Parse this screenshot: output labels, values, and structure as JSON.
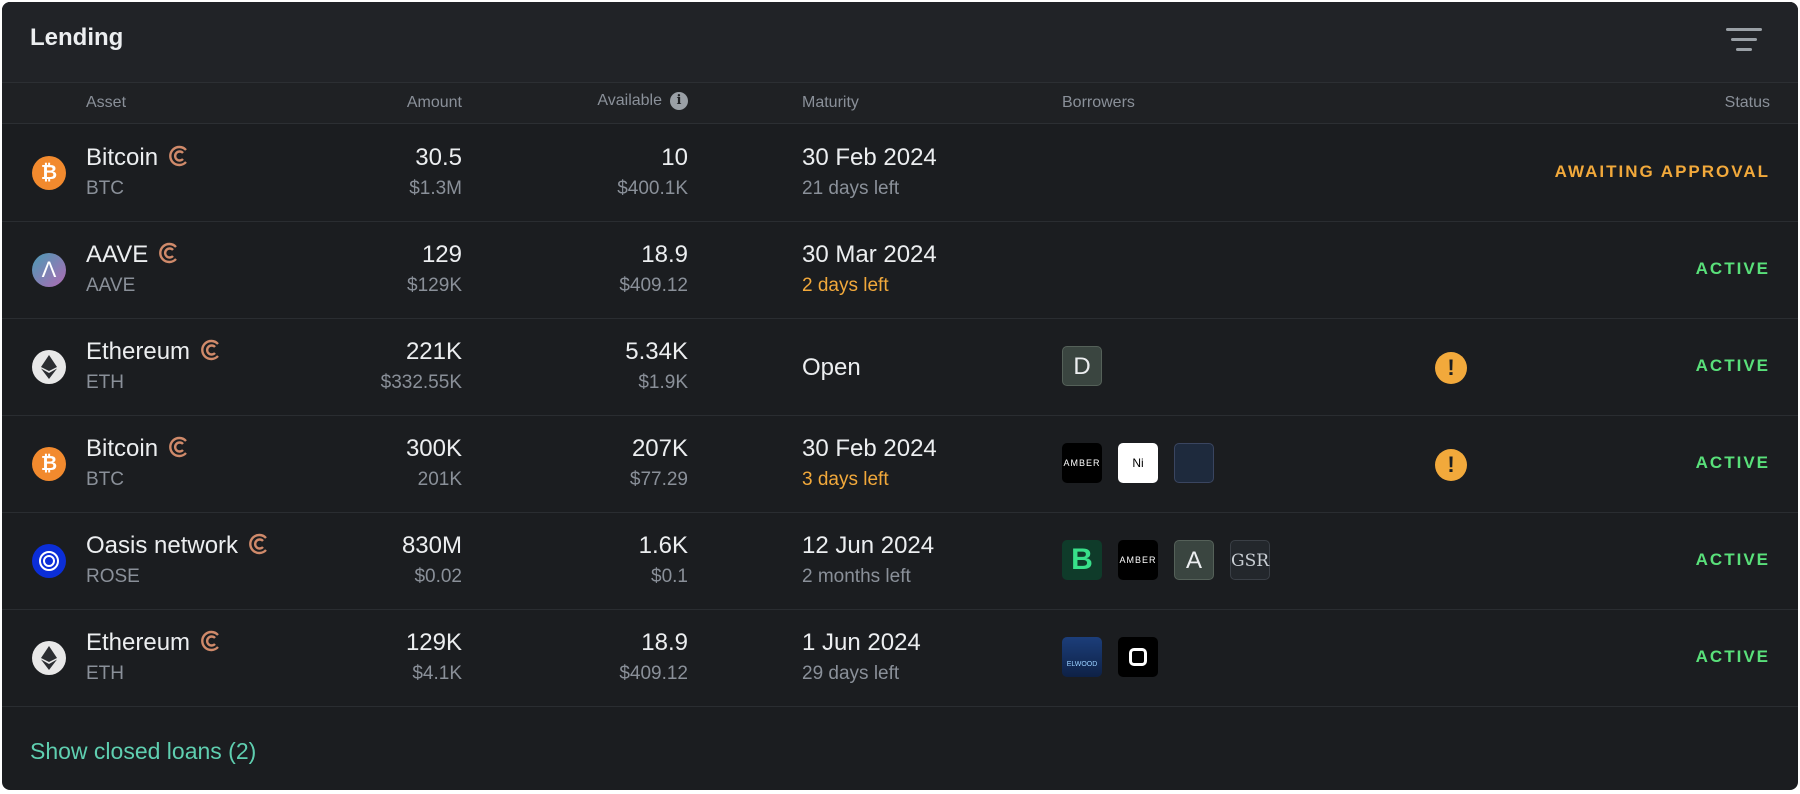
{
  "panel": {
    "title": "Lending"
  },
  "columns": {
    "asset": "Asset",
    "amount": "Amount",
    "available": "Available",
    "maturity": "Maturity",
    "borrowers": "Borrowers",
    "status": "Status"
  },
  "rows": [
    {
      "name": "Bitcoin",
      "symbol": "BTC",
      "coin_icon": "bitcoin-icon",
      "amount": "30.5",
      "amount_usd": "$1.3M",
      "available": "10",
      "available_usd": "$400.1K",
      "maturity_date": "30 Feb 2024",
      "maturity_left": "21 days left",
      "maturity_warn": false,
      "borrowers": [],
      "alert": false,
      "status": "AWAITING APPROVAL"
    },
    {
      "name": "AAVE",
      "symbol": "AAVE",
      "coin_icon": "aave-icon",
      "amount": "129",
      "amount_usd": "$129K",
      "available": "18.9",
      "available_usd": "$409.12",
      "maturity_date": "30 Mar 2024",
      "maturity_left": "2 days left",
      "maturity_warn": true,
      "borrowers": [],
      "alert": false,
      "status": "ACTIVE"
    },
    {
      "name": "Ethereum",
      "symbol": "ETH",
      "coin_icon": "ethereum-icon",
      "amount": "221K",
      "amount_usd": "$332.55K",
      "available": "5.34K",
      "available_usd": "$1.9K",
      "maturity_open": "Open",
      "borrowers": [
        "D"
      ],
      "alert": true,
      "status": "ACTIVE"
    },
    {
      "name": "Bitcoin",
      "symbol": "BTC",
      "coin_icon": "bitcoin-icon",
      "amount": "300K",
      "amount_usd": "201K",
      "available": "207K",
      "available_usd": "$77.29",
      "maturity_date": "30 Feb 2024",
      "maturity_left": "3 days left",
      "maturity_warn": true,
      "borrowers": [
        "AMBER",
        "Ni",
        "logo"
      ],
      "alert": true,
      "status": "ACTIVE"
    },
    {
      "name": "Oasis network",
      "symbol": "ROSE",
      "coin_icon": "oasis-icon",
      "amount": "830M",
      "amount_usd": "$0.02",
      "available": "1.6K",
      "available_usd": "$0.1",
      "maturity_date": "12 Jun 2024",
      "maturity_left": "2 months left",
      "maturity_warn": false,
      "borrowers": [
        "B",
        "AMBER",
        "A",
        "GSR"
      ],
      "alert": false,
      "status": "ACTIVE"
    },
    {
      "name": "Ethereum",
      "symbol": "ETH",
      "coin_icon": "ethereum-icon",
      "amount": "129K",
      "amount_usd": "$4.1K",
      "available": "18.9",
      "available_usd": "$409.12",
      "maturity_date": "1 Jun 2024",
      "maturity_left": "29 days left",
      "maturity_warn": false,
      "borrowers": [
        "ELWOOD",
        "square"
      ],
      "alert": false,
      "status": "ACTIVE"
    }
  ],
  "footer": {
    "show_closed": "Show closed loans (2)"
  },
  "colors": {
    "background": "#1b1d20",
    "awaiting": "#f2a93b",
    "active": "#59e07a",
    "link": "#5fcfb0"
  }
}
